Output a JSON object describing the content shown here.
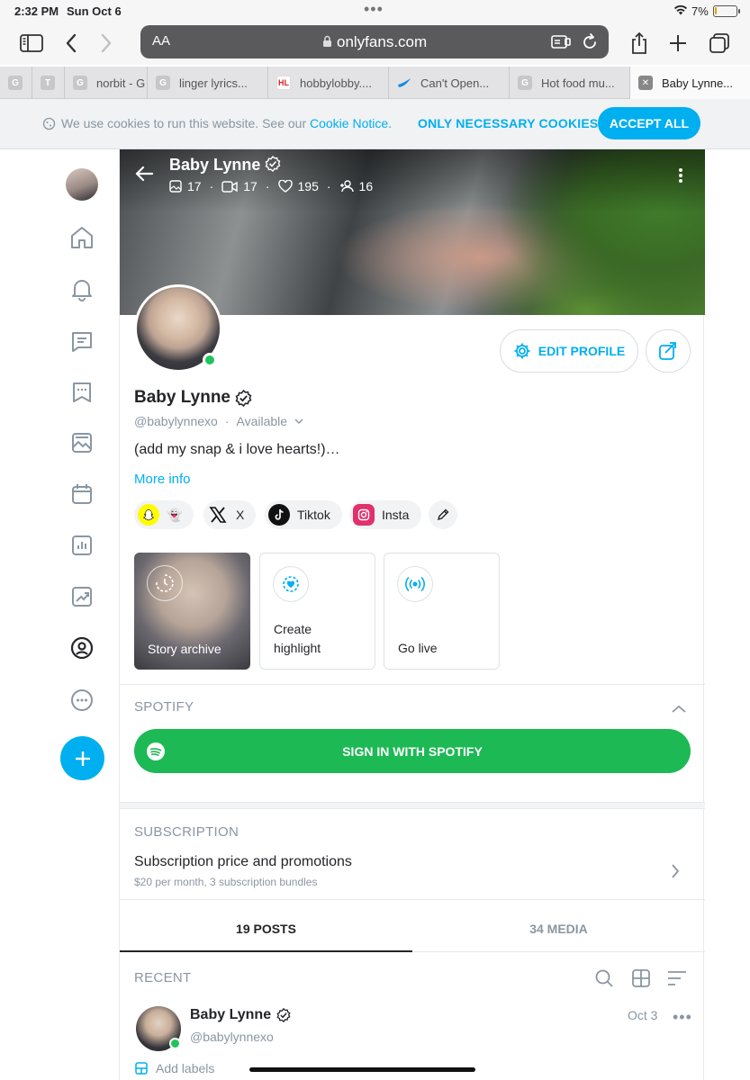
{
  "status_bar": {
    "time": "2:32 PM",
    "date": "Sun Oct 6",
    "battery": "7%",
    "battery_level": 0.07
  },
  "browser": {
    "text_size": "AA",
    "url": "onlyfans.com"
  },
  "tabs": [
    {
      "favicon": "G",
      "label": ""
    },
    {
      "favicon": "T",
      "label": ""
    },
    {
      "favicon": "G",
      "label": "norbit - G"
    },
    {
      "favicon": "G",
      "label": "linger lyrics..."
    },
    {
      "favicon": "HL",
      "label": "hobbylobby...."
    },
    {
      "favicon": "",
      "label": "Can't Open..."
    },
    {
      "favicon": "G",
      "label": "Hot food mu..."
    },
    {
      "favicon": "",
      "label": "Baby Lynne..."
    }
  ],
  "cookie_banner": {
    "text": "We use cookies to run this website. See our",
    "link": "Cookie Notice.",
    "necessary": "ONLY NECESSARY COOKIES",
    "accept": "ACCEPT ALL"
  },
  "profile": {
    "name": "Baby Lynne",
    "stats": {
      "photos": "17",
      "videos": "17",
      "likes": "195",
      "fans": "16"
    },
    "handle": "@babylynnexo",
    "status": "Available",
    "bio": "(add my snap & i love hearts!)…",
    "more_info": "More info",
    "edit_profile": "EDIT PROFILE"
  },
  "socials": [
    {
      "icon": "snapchat-icon",
      "label": "👻"
    },
    {
      "icon": "x-icon",
      "label": "X"
    },
    {
      "icon": "tiktok-icon",
      "label": "Tiktok"
    },
    {
      "icon": "instagram-icon",
      "label": "Insta"
    }
  ],
  "stories": {
    "archive": "Story archive",
    "create_highlight": "Create highlight",
    "go_live": "Go live"
  },
  "spotify": {
    "title": "SPOTIFY",
    "button": "SIGN IN WITH SPOTIFY"
  },
  "subscription": {
    "title": "SUBSCRIPTION",
    "heading": "Subscription price and promotions",
    "detail": "$20 per month, 3 subscription bundles"
  },
  "content_tabs": {
    "posts": "19 POSTS",
    "media": "34 MEDIA"
  },
  "recent": {
    "title": "RECENT",
    "post": {
      "name": "Baby Lynne",
      "handle": "@babylynnexo",
      "date": "Oct 3",
      "add_labels": "Add labels"
    }
  },
  "colors": {
    "accent": "#00aff0",
    "spotify": "#1db954",
    "online": "#21c35d"
  }
}
